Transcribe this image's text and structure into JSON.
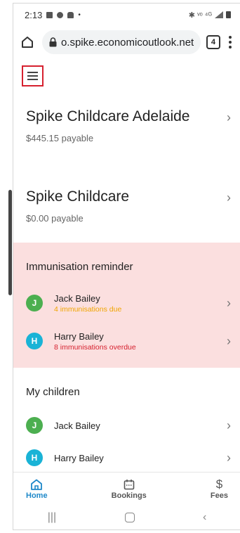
{
  "status_bar": {
    "time": "2:13",
    "right_text": "✱ ᵛᵒ ⁴ᴳ"
  },
  "browser": {
    "url": "o.spike.economicoutlook.net",
    "tab_count": "4"
  },
  "centres": [
    {
      "name": "Spike Childcare Adelaide",
      "amount": "$445.15 payable"
    },
    {
      "name": "Spike Childcare",
      "amount": "$0.00 payable"
    }
  ],
  "reminder": {
    "title": "Immunisation reminder",
    "children": [
      {
        "initial": "J",
        "name": "Jack Bailey",
        "status": "4 immunisations due",
        "avatar_color": "#4caf50",
        "status_color": "#f0a500"
      },
      {
        "initial": "H",
        "name": "Harry Bailey",
        "status": "8 immunisations overdue",
        "avatar_color": "#1ab3d6",
        "status_color": "#d6212f"
      }
    ]
  },
  "my_children": {
    "title": "My children",
    "children": [
      {
        "initial": "J",
        "name": "Jack Bailey",
        "avatar_color": "#4caf50"
      },
      {
        "initial": "H",
        "name": "Harry Bailey",
        "avatar_color": "#1ab3d6"
      }
    ]
  },
  "bottom_nav": {
    "home": "Home",
    "bookings": "Bookings",
    "fees": "Fees"
  },
  "colors": {
    "accent": "#1e88c9",
    "reminder_bg": "#fbdfdf",
    "menu_highlight": "#d6212f"
  }
}
